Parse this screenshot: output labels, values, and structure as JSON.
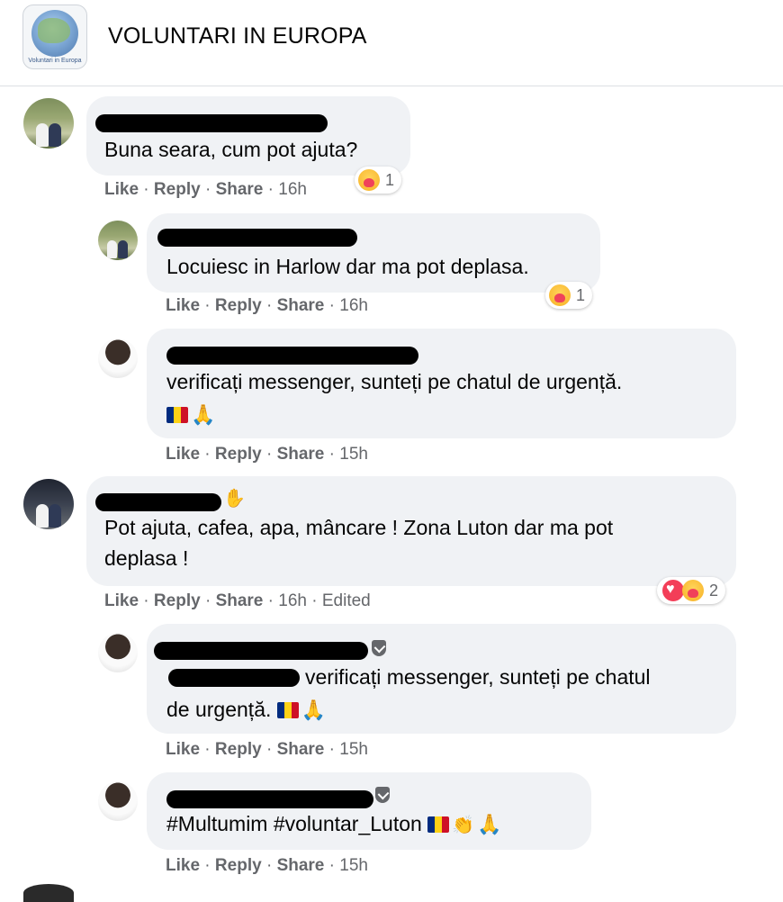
{
  "group": {
    "name": "VOLUNTARI IN EUROPA",
    "logo_text": "Voluntari in Europa"
  },
  "action_labels": {
    "like": "Like",
    "reply": "Reply",
    "share": "Share",
    "sep": " · "
  },
  "comments": [
    {
      "text": "Buna seara, cum pot ajuta?",
      "time": "16h",
      "reaction_count": "1"
    },
    {
      "text": "Locuiesc in Harlow dar ma pot deplasa.",
      "time": "16h",
      "reaction_count": "1"
    },
    {
      "text": "verificați messenger, sunteți pe chatul de urgență.",
      "time": "15h"
    },
    {
      "line1": "Pot ajuta, cafea, apa, mâncare ! Zona Luton dar ma pot",
      "line2": "deplasa !",
      "time": "16h",
      "edited": "Edited",
      "reaction_count": "2"
    },
    {
      "line1": "verificați messenger, sunteți pe chatul",
      "line2": "de urgență.",
      "time": "15h"
    },
    {
      "text": "#Multumim #voluntar_Luton",
      "time": "15h"
    }
  ]
}
